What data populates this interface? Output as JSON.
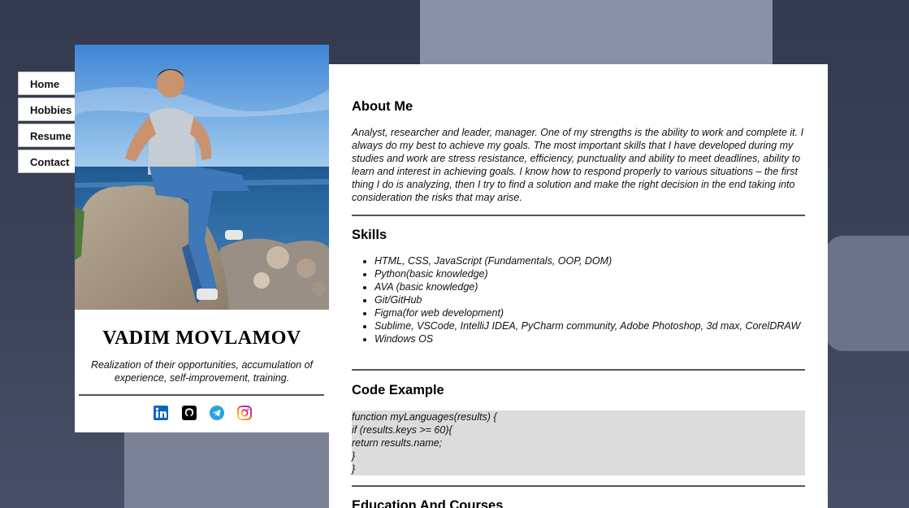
{
  "nav": {
    "items": [
      {
        "label": "Home"
      },
      {
        "label": "Hobbies"
      },
      {
        "label": "Resume"
      },
      {
        "label": "Contact"
      }
    ]
  },
  "profile": {
    "name": "VADIM MOVLAMOV",
    "tagline": "Realization of their opportunities, accumulation of experience, self-improvement, training.",
    "socials": [
      "linkedin-icon",
      "github-icon",
      "telegram-icon",
      "instagram-icon"
    ]
  },
  "about": {
    "title": "About Me",
    "text": "Analyst, researcher and leader, manager. One of my strengths is the ability to work and complete it. I always do my best to achieve my goals. The most important skills that I have developed during my studies and work are stress resistance, efficiency, punctuality and ability to meet deadlines, ability to learn and interest in achieving goals. I know how to respond properly to various situations – the first thing I do is analyzing, then I try to find a solution and make the right decision in the end taking into consideration the risks that may arise."
  },
  "skills": {
    "title": "Skills",
    "items": [
      "HTML, CSS, JavaScript (Fundamentals, OOP, DOM)",
      "Python(basic knowledge)",
      "AVA (basic knowledge)",
      "Git/GitHub",
      "Figma(for web development)",
      "Sublime, VSCode, IntelliJ IDEA, PyCharm community, Adobe Photoshop, 3d max, CorelDRAW",
      "Windows OS"
    ]
  },
  "code_example": {
    "title": "Code Example",
    "code": "function myLanguages(results) {\nif (results.keys >= 60){\nreturn results.name;\n}\n}"
  },
  "education": {
    "title": "Education And Courses"
  },
  "colors": {
    "background": "#3b4256",
    "card": "#ffffff",
    "code_bg": "#dcdcdc",
    "linkedin": "#0a66c2",
    "telegram": "#2aa3de"
  }
}
